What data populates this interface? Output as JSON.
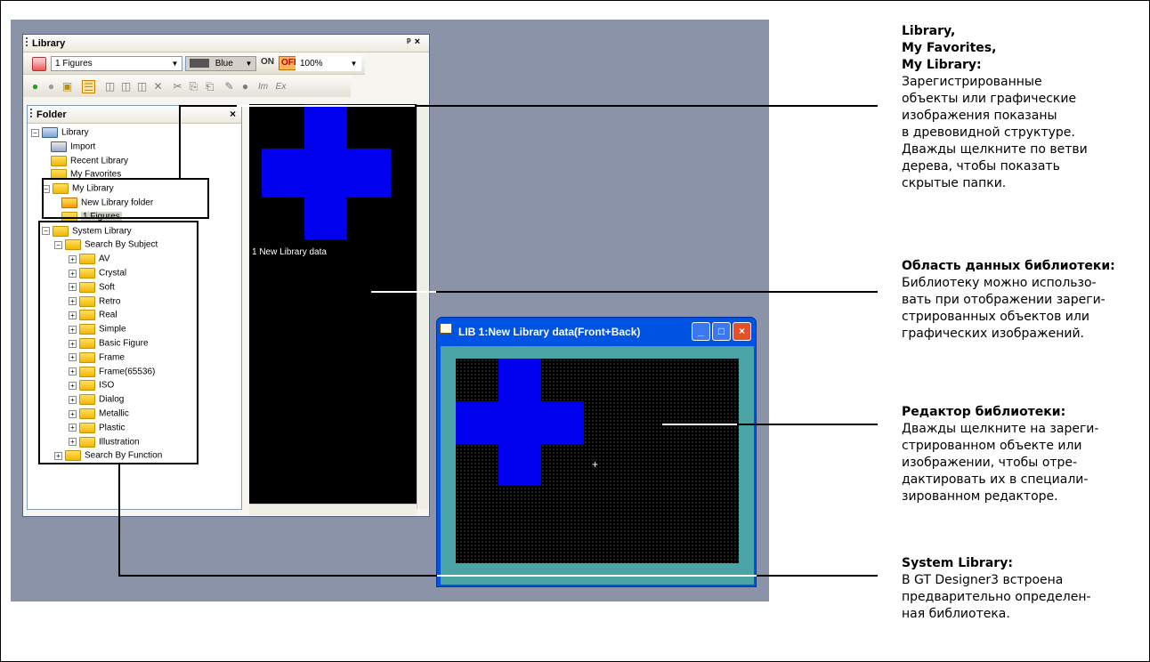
{
  "library_window": {
    "title": "Library",
    "title_buttons": "&#x2758; ×",
    "figures_combo": "1 Figures",
    "color_combo": "Blue",
    "on_label": "ON",
    "off_label": "OFF",
    "zoom_combo": "100%",
    "folder_pane_title": "Folder",
    "preview_item_label": "1 New Library data"
  },
  "tree": [
    {
      "label": "Library",
      "icon": "library-root-icon",
      "toggle": "−"
    },
    {
      "label": "Import",
      "icon": "import-icon"
    },
    {
      "label": "Recent Library",
      "icon": "folder-icon"
    },
    {
      "label": "My Favorites",
      "icon": "folder-icon"
    },
    {
      "label": "My Library",
      "icon": "folder-icon",
      "toggle": "−"
    },
    {
      "label": "New Library folder",
      "icon": "new-folder-icon"
    },
    {
      "label": "1 Figures",
      "icon": "open-folder-icon"
    },
    {
      "label": "System Library",
      "icon": "folder-icon",
      "toggle": "−"
    },
    {
      "label": "Search By Subject",
      "icon": "folder-icon",
      "toggle": "−"
    },
    {
      "label": "AV",
      "icon": "folder-icon",
      "toggle": "+"
    },
    {
      "label": "Crystal",
      "icon": "folder-icon",
      "toggle": "+"
    },
    {
      "label": "Soft",
      "icon": "folder-icon",
      "toggle": "+"
    },
    {
      "label": "Retro",
      "icon": "folder-icon",
      "toggle": "+"
    },
    {
      "label": "Real",
      "icon": "folder-icon",
      "toggle": "+"
    },
    {
      "label": "Simple",
      "icon": "folder-icon",
      "toggle": "+"
    },
    {
      "label": "Basic Figure",
      "icon": "folder-icon",
      "toggle": "+"
    },
    {
      "label": "Frame",
      "icon": "folder-icon",
      "toggle": "+"
    },
    {
      "label": "Frame(65536)",
      "icon": "folder-icon",
      "toggle": "+"
    },
    {
      "label": "ISO",
      "icon": "folder-icon",
      "toggle": "+"
    },
    {
      "label": "Dialog",
      "icon": "folder-icon",
      "toggle": "+"
    },
    {
      "label": "Metallic",
      "icon": "folder-icon",
      "toggle": "+"
    },
    {
      "label": "Plastic",
      "icon": "folder-icon",
      "toggle": "+"
    },
    {
      "label": "Illustration",
      "icon": "folder-icon",
      "toggle": "+"
    },
    {
      "label": "Search By Function",
      "icon": "folder-icon",
      "toggle": "+"
    }
  ],
  "editor_window": {
    "title": "LIB 1:New Library data(Front+Back)",
    "cursor": "+"
  },
  "annotations": [
    {
      "heading_lines": [
        "Library,",
        "My Favorites,",
        "My Library:"
      ],
      "body_lines": [
        "Зарегистрированные",
        "объекты или графические",
        "изображения показаны",
        "в древовидной структуре.",
        "Дважды щелкните по ветви",
        "дерева, чтобы показать",
        "скрытые папки."
      ]
    },
    {
      "heading_lines": [
        "Область данных библиотеки:"
      ],
      "body_lines": [
        "Библиотеку можно использо-",
        "вать при отображении зареги-",
        "стрированных объектов или",
        "графических изображений."
      ]
    },
    {
      "heading_lines": [
        "Редактор библиотеки:"
      ],
      "body_lines": [
        "Дважды щелкните на зареги-",
        "стрированном объекте или",
        "изображении, чтобы отре-",
        "дактировать их в специали-",
        "зированном редакторе."
      ]
    },
    {
      "heading_lines": [
        "System Library:"
      ],
      "body_lines": [
        "В GT Designer3 встроена",
        "предварительно определен-",
        "ная библиотека."
      ]
    }
  ],
  "colors": {
    "desktop": "#8b93a8",
    "figure": "#0000ee",
    "editor_title": "#0054e3",
    "editor_bg": "#4aa3a5"
  }
}
